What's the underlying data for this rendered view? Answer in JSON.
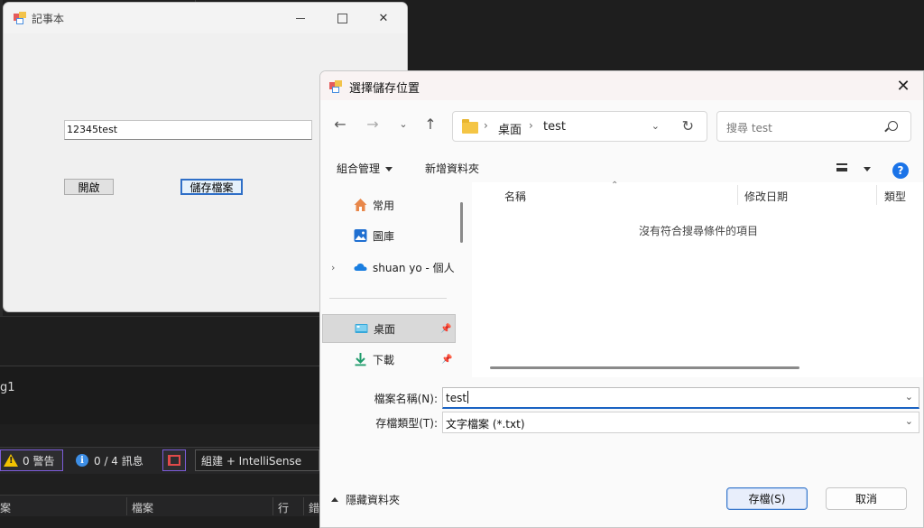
{
  "ide": {
    "output_label": "g1",
    "warnings": "0 警告",
    "messages": "0 / 4 訊息",
    "build_filter": "組建 + IntelliSense",
    "columns": [
      "案",
      "檔案",
      "行",
      "錯"
    ]
  },
  "notepad": {
    "title": "記事本",
    "textbox_value": "12345test",
    "open_button": "開啟",
    "save_button": "儲存檔案"
  },
  "dialog": {
    "title": "選擇儲存位置",
    "breadcrumb": [
      "桌面",
      "test"
    ],
    "search_placeholder": "搜尋 test",
    "organize": "組合管理",
    "new_folder": "新增資料夾",
    "nav_items": [
      {
        "label": "常用",
        "icon": "home-icon"
      },
      {
        "label": "圖庫",
        "icon": "gallery-icon"
      },
      {
        "label": "shuan yo - 個人",
        "icon": "onedrive-cloud-icon"
      },
      {
        "label": "桌面",
        "icon": "desktop-icon"
      },
      {
        "label": "下載",
        "icon": "download-icon"
      }
    ],
    "columns": [
      "名稱",
      "修改日期",
      "類型"
    ],
    "empty_message": "沒有符合搜尋條件的項目",
    "filename_label": "檔案名稱(N):",
    "filename_value": "test",
    "filetype_label": "存檔類型(T):",
    "filetype_value": "文字檔案 (*.txt)",
    "hide_folders": "隱藏資料夾",
    "save_button": "存檔(S)",
    "cancel_button": "取消"
  }
}
